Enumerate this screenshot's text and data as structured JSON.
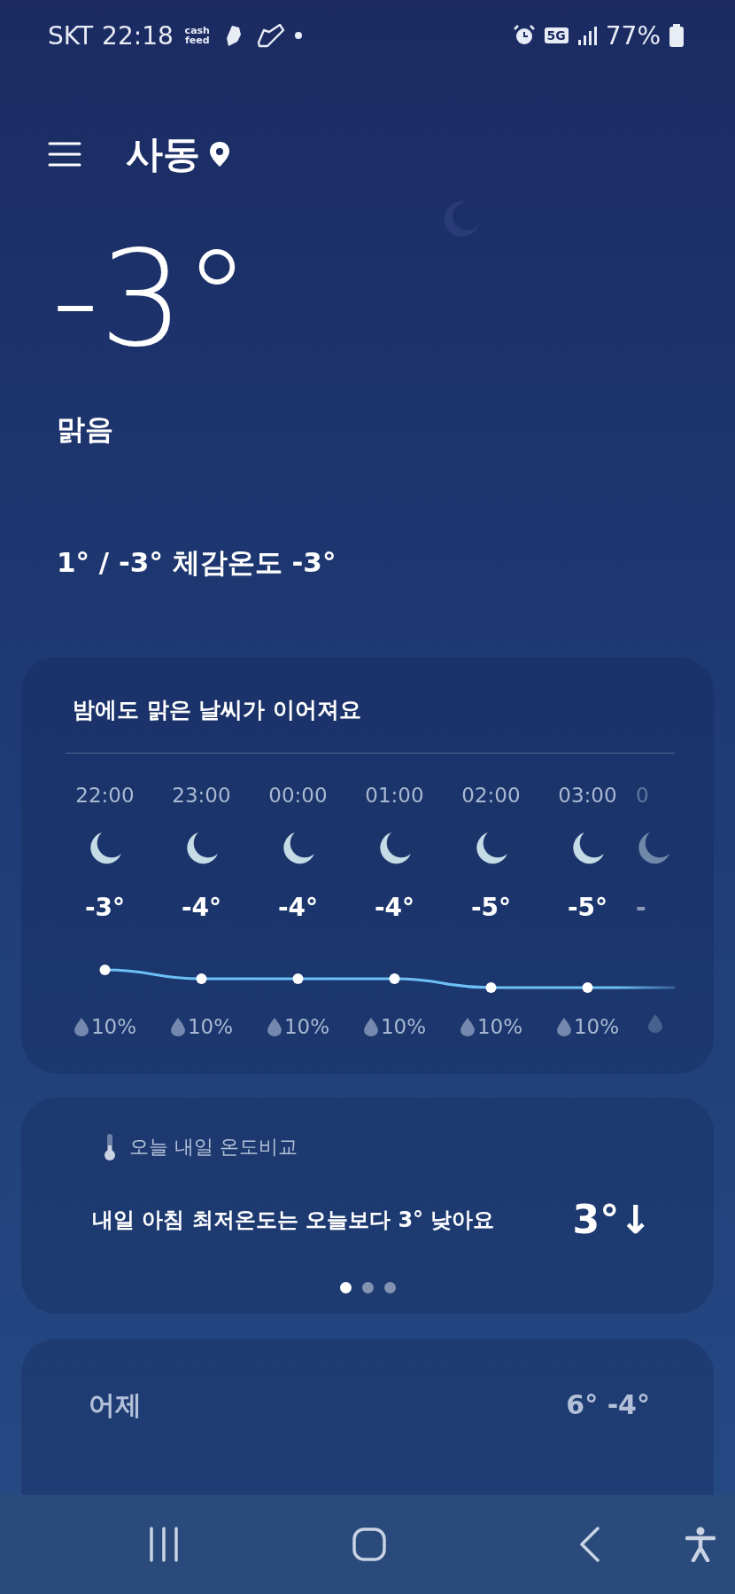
{
  "status_bar": {
    "carrier": "SKT",
    "time": "22:18",
    "app_badge": "cash feed",
    "network": "5G",
    "battery": "77%"
  },
  "location": {
    "name": "사동"
  },
  "current": {
    "temperature": "-3°",
    "condition": "맑음",
    "summary": "1° / -3° 체감온도 -3°"
  },
  "hourly_card": {
    "title": "밤에도 맑은 날씨가 이어져요",
    "hours": [
      {
        "time": "22:00",
        "temp": "-3°",
        "precip": "10%",
        "partial": false
      },
      {
        "time": "23:00",
        "temp": "-4°",
        "precip": "10%",
        "partial": false
      },
      {
        "time": "00:00",
        "temp": "-4°",
        "precip": "10%",
        "partial": false
      },
      {
        "time": "01:00",
        "temp": "-4°",
        "precip": "10%",
        "partial": false
      },
      {
        "time": "02:00",
        "temp": "-5°",
        "precip": "10%",
        "partial": false
      },
      {
        "time": "03:00",
        "temp": "-5°",
        "precip": "10%",
        "partial": false
      },
      {
        "time": "0",
        "temp": "-",
        "partial": true
      }
    ]
  },
  "comparison_card": {
    "label": "오늘 내일 온도비교",
    "message": "내일 아침 최저온도는 오늘보다 3° 낮아요",
    "difference": "3°↓",
    "pages": [
      {
        "selected": true
      },
      {
        "selected": false
      },
      {
        "selected": false
      }
    ]
  },
  "daily_card": {
    "rows": [
      {
        "day": "어제",
        "temps": "6° -4°"
      }
    ]
  }
}
